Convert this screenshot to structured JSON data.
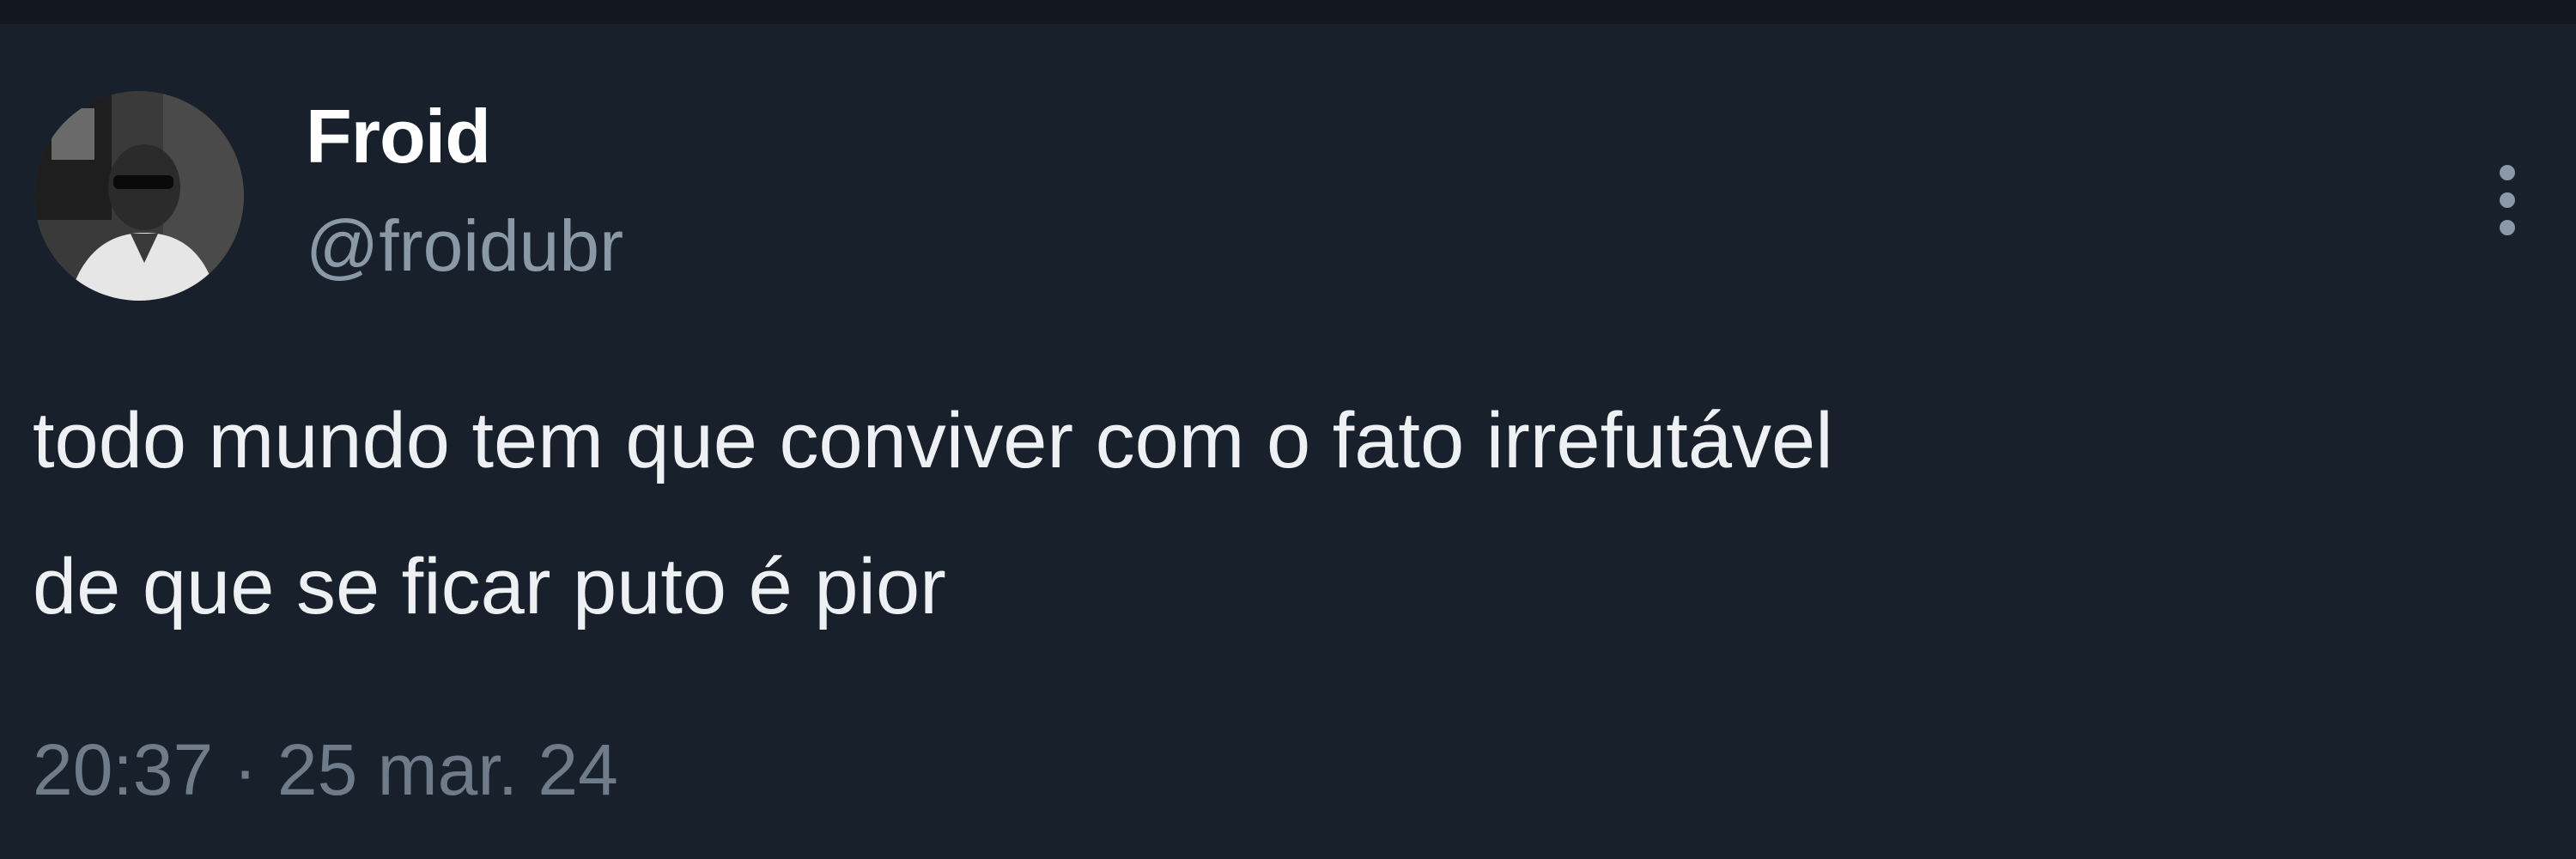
{
  "tweet": {
    "author": {
      "display_name": "Froid",
      "handle": "@froidubr",
      "avatar_icon": "profile-photo"
    },
    "more_icon": "more-vertical-icon",
    "text_lines": [
      "todo mundo tem que conviver com o fato irrefutável",
      "de que se ficar puto é pior"
    ],
    "time": "20:37",
    "separator": "·",
    "date": "25 mar. 24"
  },
  "colors": {
    "background": "#17202b",
    "name": "#ffffff",
    "handle": "#8b98a5",
    "body_text": "#eef1f3",
    "timestamp": "#6f7b88"
  }
}
